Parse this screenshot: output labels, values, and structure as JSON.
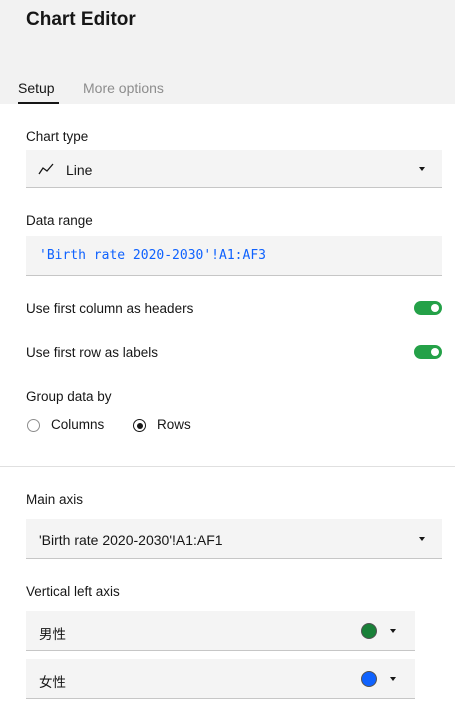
{
  "header": {
    "title": "Chart Editor",
    "tabs": [
      {
        "label": "Setup",
        "active": true
      },
      {
        "label": "More options",
        "active": false
      }
    ]
  },
  "setup": {
    "chart_type": {
      "label": "Chart type",
      "value": "Line",
      "icon": "line-chart-icon"
    },
    "data_range": {
      "label": "Data range",
      "value": "'Birth rate 2020-2030'!A1:AF3"
    },
    "first_column_headers": {
      "label": "Use first column as headers",
      "checked": true
    },
    "first_row_labels": {
      "label": "Use first row as labels",
      "checked": true
    },
    "group_data_by": {
      "label": "Group data by",
      "options": [
        {
          "label": "Columns",
          "selected": false
        },
        {
          "label": "Rows",
          "selected": true
        }
      ]
    },
    "main_axis": {
      "label": "Main axis",
      "value": "'Birth rate 2020-2030'!A1:AF1"
    },
    "vertical_left_axis": {
      "label": "Vertical left axis",
      "series": [
        {
          "name": "男性",
          "color": "#198038"
        },
        {
          "name": "女性",
          "color": "#0f62fe"
        }
      ]
    }
  },
  "colors": {
    "accent": "#24a148",
    "link": "#0f62fe"
  }
}
